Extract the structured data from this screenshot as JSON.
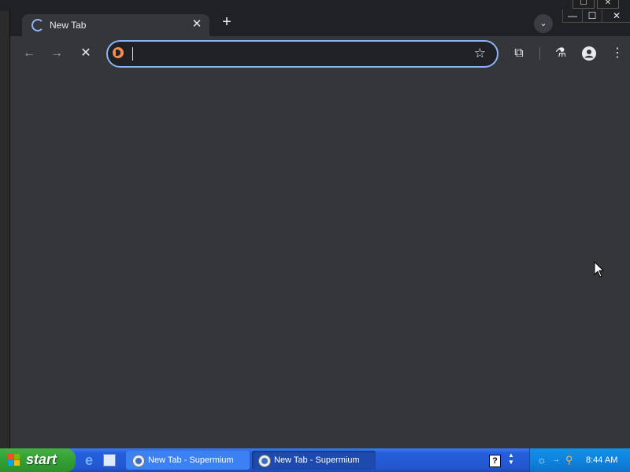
{
  "browser": {
    "tab": {
      "title": "New Tab",
      "close_glyph": "✕"
    },
    "new_tab_glyph": "+",
    "tab_search_glyph": "⌄",
    "window_controls": {
      "minimize": "—",
      "maximize": "☐",
      "close": "✕"
    },
    "toolbar": {
      "back": "←",
      "forward": "→",
      "stop": "✕",
      "extensions_glyph": "⧉",
      "labs_glyph": "⚗",
      "menu_glyph": "⋮"
    },
    "omnibox": {
      "value": "",
      "star_glyph": "☆"
    }
  },
  "taskbar": {
    "start_label": "start",
    "tasks": [
      {
        "label": "New Tab - Supermium"
      },
      {
        "label": "New Tab - Supermium"
      }
    ],
    "help_glyph": "?",
    "updown_glyph": "▲\n▼",
    "clock": "8:44 AM"
  },
  "icons": {
    "tab": "loading-spinner-icon",
    "site": "duckduckgo-icon",
    "profile": "person-icon"
  },
  "colors": {
    "accent": "#8ab4f8",
    "frame": "#202124",
    "toolbar": "#35363a",
    "taskbar": "#245edb",
    "start": "#35a236",
    "tray": "#0f83dd"
  }
}
